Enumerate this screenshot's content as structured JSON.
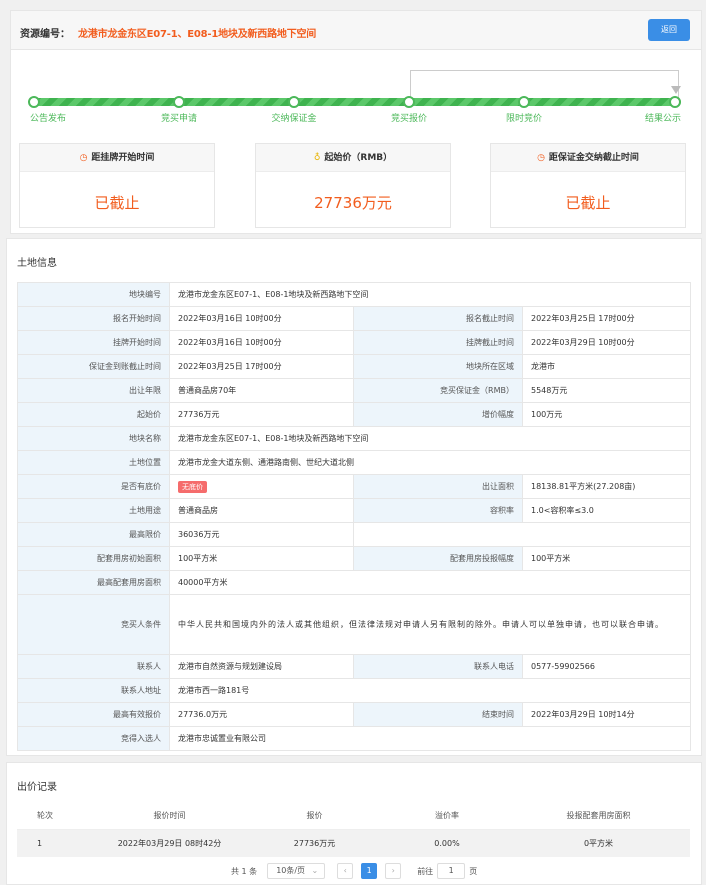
{
  "header": {
    "label": "资源编号：",
    "value": "龙港市龙金东区E07-1、E08-1地块及新西路地下空间",
    "back_label": "返回"
  },
  "progress": {
    "steps": [
      "公告发布",
      "竞买申请",
      "交纳保证金",
      "竞买报价",
      "限时竞价",
      "结果公示"
    ],
    "percent": 100
  },
  "info_boxes": [
    {
      "icon": "clock-icon",
      "title": "距挂牌开始时间",
      "value": "已截止"
    },
    {
      "icon": "money-bag-icon",
      "title": "起始价（RMB）",
      "value": "27736万元"
    },
    {
      "icon": "clock-icon",
      "title": "距保证金交纳截止时间",
      "value": "已截止"
    }
  ],
  "land": {
    "title": "土地信息",
    "rows": {
      "plot_no_k": "地块编号",
      "plot_no": "龙港市龙金东区E07-1、E08-1地块及新西路地下空间",
      "reg_start_k": "报名开始时间",
      "reg_start": "2022年03月16日 10时00分",
      "reg_end_k": "报名截止时间",
      "reg_end": "2022年03月25日 17时00分",
      "list_start_k": "挂牌开始时间",
      "list_start": "2022年03月16日 10时00分",
      "list_end_k": "挂牌截止时间",
      "list_end": "2022年03月29日 10时00分",
      "deposit_end_k": "保证金到账截止时间",
      "deposit_end": "2022年03月25日 17时00分",
      "region_k": "地块所在区域",
      "region": "龙港市",
      "term_k": "出让年限",
      "term": "普通商品房70年",
      "deposit_k": "竞买保证金（RMB）",
      "deposit": "5548万元",
      "start_price_k": "起始价",
      "start_price": "27736万元",
      "increment_k": "增价幅度",
      "increment": "100万元",
      "name_k": "地块名称",
      "name": "龙港市龙金东区E07-1、E08-1地块及新西路地下空间",
      "location_k": "土地位置",
      "location": "龙港市龙金大道东侧、通港路南侧、世纪大道北侧",
      "reserve_k": "是否有底价",
      "reserve_tag": "无底价",
      "area_k": "出让面积",
      "area": "18138.81平方米(27.208亩)",
      "use_k": "土地用途",
      "use": "普通商品房",
      "far_k": "容积率",
      "far": "1.0<容积率≤3.0",
      "max_price_k": "最高限价",
      "max_price": "36036万元",
      "supp_init_k": "配套用房初始面积",
      "supp_init": "100平方米",
      "supp_step_k": "配套用房投报幅度",
      "supp_step": "100平方米",
      "supp_max_k": "最高配套用房面积",
      "supp_max": "40000平方米",
      "bidder_req_k": "竞买人条件",
      "bidder_req": "中华人民共和国境内外的法人或其他组织，但法律法规对申请人另有限制的除外。申请人可以单独申请，也可以联合申请。",
      "contact_k": "联系人",
      "contact": "龙港市自然资源与规划建设局",
      "phone_k": "联系人电话",
      "phone": "0577-59902566",
      "address_k": "联系人地址",
      "address": "龙港市西一路181号",
      "top_bid_k": "最高有效报价",
      "top_bid": "27736.0万元",
      "end_time_k": "结束时间",
      "end_time": "2022年03月29日 10时14分",
      "winner_k": "竞得入选人",
      "winner": "龙港市忠诚置业有限公司"
    }
  },
  "bids": {
    "title": "出价记录",
    "columns": [
      "轮次",
      "报价时间",
      "报价",
      "溢价率",
      "投报配套用房面积"
    ],
    "rows": [
      [
        "1",
        "2022年03月29日 08时42分",
        "27736万元",
        "0.00%",
        "0平方米"
      ]
    ]
  },
  "pager": {
    "total": "共 1 条",
    "page_size": "10条/页",
    "current": "1",
    "goto_label": "前往",
    "goto_value": "1",
    "page_unit": "页"
  }
}
